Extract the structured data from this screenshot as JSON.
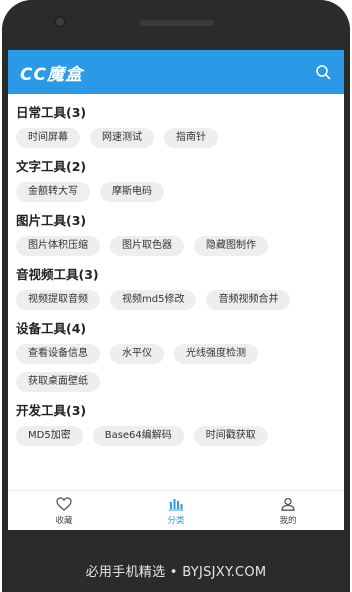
{
  "app": {
    "title": "CC魔盒",
    "accent": "#2a9ae6"
  },
  "header": {
    "search_icon": "search-icon"
  },
  "sections": [
    {
      "title": "日常工具(3)",
      "tools": [
        "时间屏幕",
        "网速测试",
        "指南针"
      ]
    },
    {
      "title": "文字工具(2)",
      "tools": [
        "金额转大写",
        "摩斯电码"
      ]
    },
    {
      "title": "图片工具(3)",
      "tools": [
        "图片体积压缩",
        "图片取色器",
        "隐藏图制作"
      ]
    },
    {
      "title": "音视频工具(3)",
      "tools": [
        "视频提取音频",
        "视频md5修改",
        "音频视频合并"
      ]
    },
    {
      "title": "设备工具(4)",
      "tools": [
        "查看设备信息",
        "水平仪",
        "光线强度检测",
        "获取桌面壁纸"
      ]
    },
    {
      "title": "开发工具(3)",
      "tools": [
        "MD5加密",
        "Base64编解码",
        "时间戳获取"
      ]
    }
  ],
  "bottom_nav": [
    {
      "label": "收藏",
      "icon": "heart-icon",
      "active": false
    },
    {
      "label": "分类",
      "icon": "category-icon",
      "active": true
    },
    {
      "label": "我的",
      "icon": "user-icon",
      "active": false
    }
  ],
  "watermark": "必用手机精选 • BYJSJXY.COM"
}
